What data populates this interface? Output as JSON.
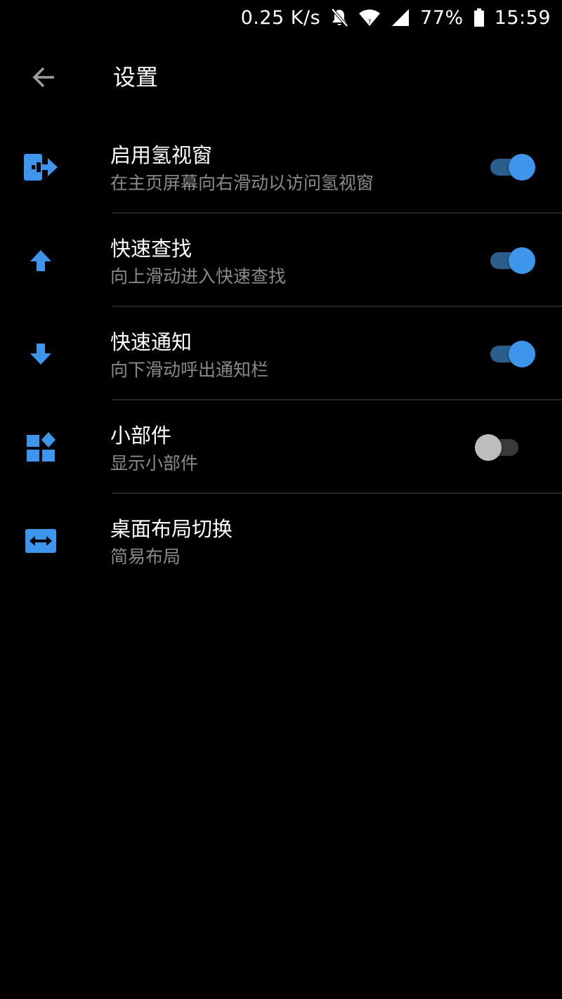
{
  "status_bar": {
    "network_speed": "0.25 K/s",
    "battery_percent": "77%",
    "time": "15:59",
    "icons": [
      "bell-off-icon",
      "wifi-icon",
      "signal-icon",
      "battery-icon"
    ]
  },
  "app_bar": {
    "title": "设置",
    "back_icon": "arrow-left-icon"
  },
  "colors": {
    "accent": "#3d96ec",
    "toggle_track_on": "#2c5e8c",
    "toggle_track_off": "#3a3a3a",
    "toggle_thumb_off": "#bdbdbd",
    "summary_text": "#8a8a8a",
    "background": "#000000"
  },
  "settings": {
    "items": [
      {
        "icon": "exit-to-right-icon",
        "title": "启用氢视窗",
        "summary": "在主页屏幕向右滑动以访问氢视窗",
        "toggle": true
      },
      {
        "icon": "arrow-up-icon",
        "title": "快速查找",
        "summary": "向上滑动进入快速查找",
        "toggle": true
      },
      {
        "icon": "arrow-down-icon",
        "title": "快速通知",
        "summary": "向下滑动呼出通知栏",
        "toggle": true
      },
      {
        "icon": "widgets-icon",
        "title": "小部件",
        "summary": "显示小部件",
        "toggle": false
      },
      {
        "icon": "swap-horizontal-icon",
        "title": "桌面布局切换",
        "summary": "简易布局",
        "toggle": null
      }
    ]
  }
}
